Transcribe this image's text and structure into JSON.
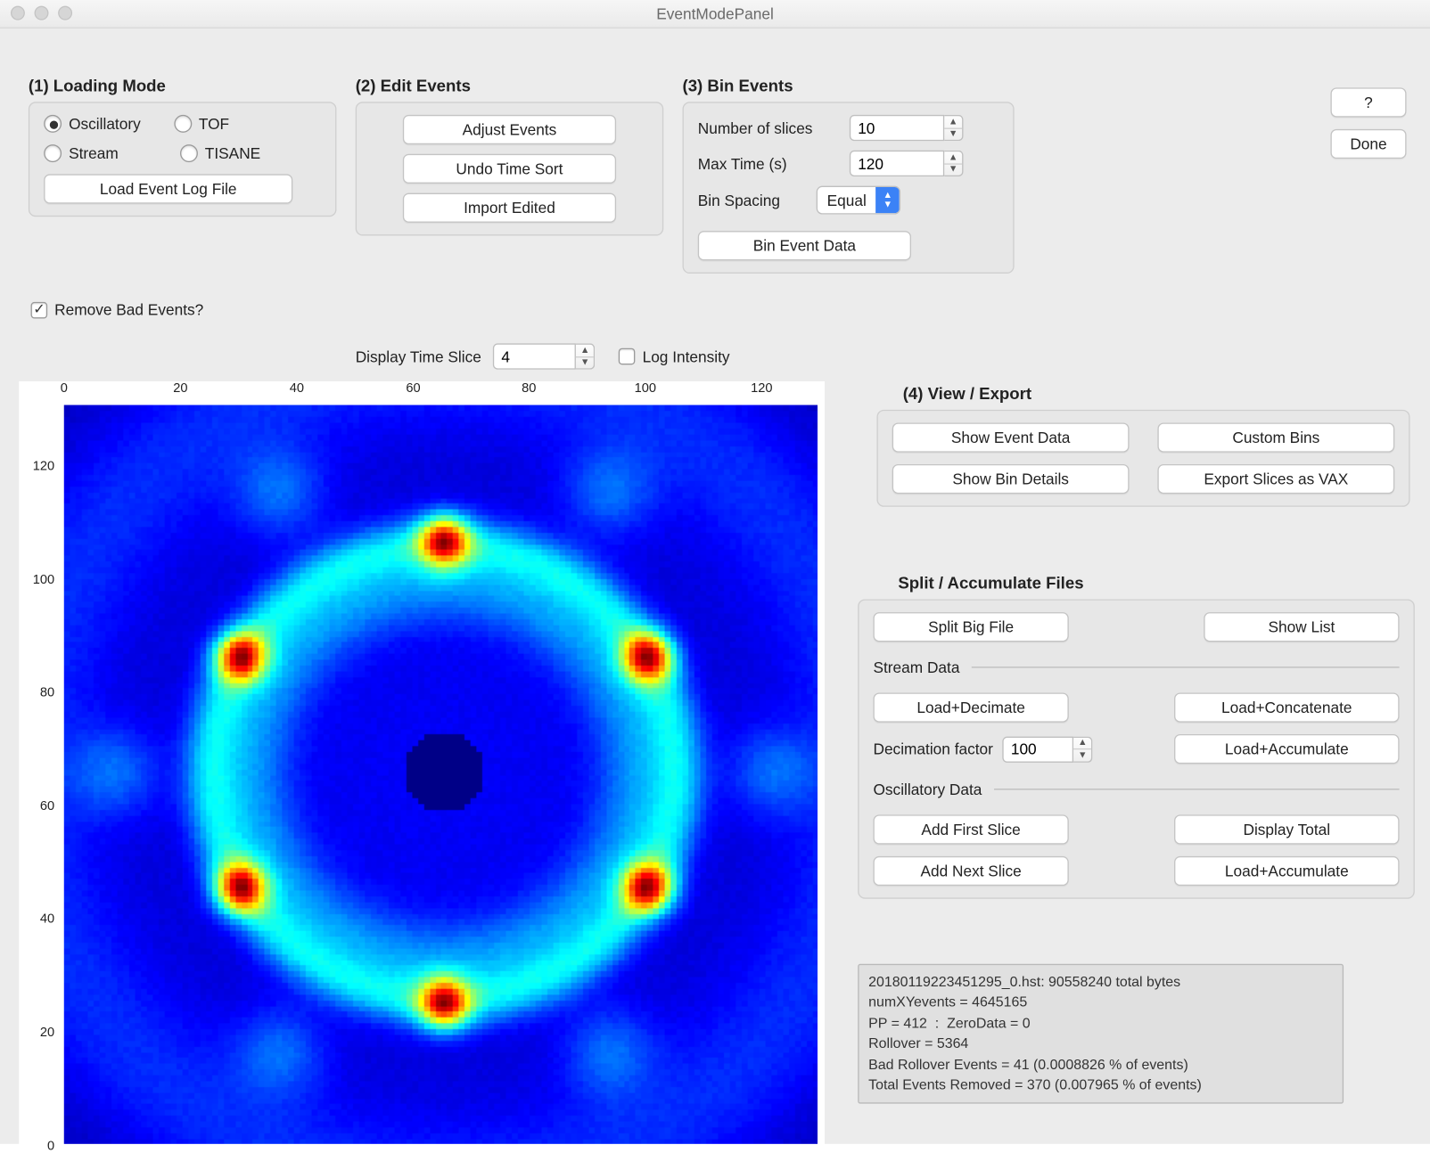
{
  "window": {
    "title": "EventModePanel"
  },
  "loading": {
    "title": "(1) Loading Mode",
    "radios": {
      "oscillatory": "Oscillatory",
      "tof": "TOF",
      "stream": "Stream",
      "tisane": "TISANE"
    },
    "selected": "oscillatory",
    "load_button": "Load Event Log File",
    "remove_bad": "Remove Bad Events?",
    "remove_bad_checked": true
  },
  "edit": {
    "title": "(2) Edit Events",
    "adjust": "Adjust Events",
    "undo": "Undo Time Sort",
    "import": "Import Edited"
  },
  "bin": {
    "title": "(3) Bin Events",
    "num_slices_label": "Number of slices",
    "num_slices": "10",
    "max_time_label": "Max Time (s)",
    "max_time": "120",
    "spacing_label": "Bin Spacing",
    "spacing_value": "Equal",
    "bin_button": "Bin Event Data"
  },
  "top_buttons": {
    "help": "?",
    "done": "Done"
  },
  "display": {
    "slice_label": "Display Time Slice",
    "slice_value": "4",
    "log_intensity": "Log Intensity",
    "log_intensity_checked": false
  },
  "plot": {
    "x_ticks": [
      "0",
      "20",
      "40",
      "60",
      "80",
      "100",
      "120"
    ],
    "y_ticks": [
      "0",
      "20",
      "40",
      "60",
      "80",
      "100",
      "120"
    ]
  },
  "view": {
    "title": "(4) View / Export",
    "show_event": "Show Event Data",
    "custom_bins": "Custom Bins",
    "show_bin_details": "Show Bin Details",
    "export_vax": "Export Slices as VAX"
  },
  "split": {
    "title": "Split / Accumulate Files",
    "split_big": "Split Big File",
    "show_list": "Show List",
    "stream_label": "Stream Data",
    "load_decimate": "Load+Decimate",
    "load_concat": "Load+Concatenate",
    "decim_label": "Decimation factor",
    "decim_value": "100",
    "load_accum_stream": "Load+Accumulate",
    "osc_label": "Oscillatory Data",
    "add_first": "Add First Slice",
    "display_total": "Display Total",
    "add_next": "Add Next Slice",
    "load_accum_osc": "Load+Accumulate"
  },
  "status": {
    "line1": "20180119223451295_0.hst: 90558240 total bytes",
    "line2": "numXYevents = 4645165",
    "line3": "PP = 412  :  ZeroData = 0",
    "line4": "Rollover = 5364",
    "line5": "Bad Rollover Events = 41 (0.0008826 % of events)",
    "line6": "Total Events Removed = 370 (0.007965 % of events)"
  }
}
